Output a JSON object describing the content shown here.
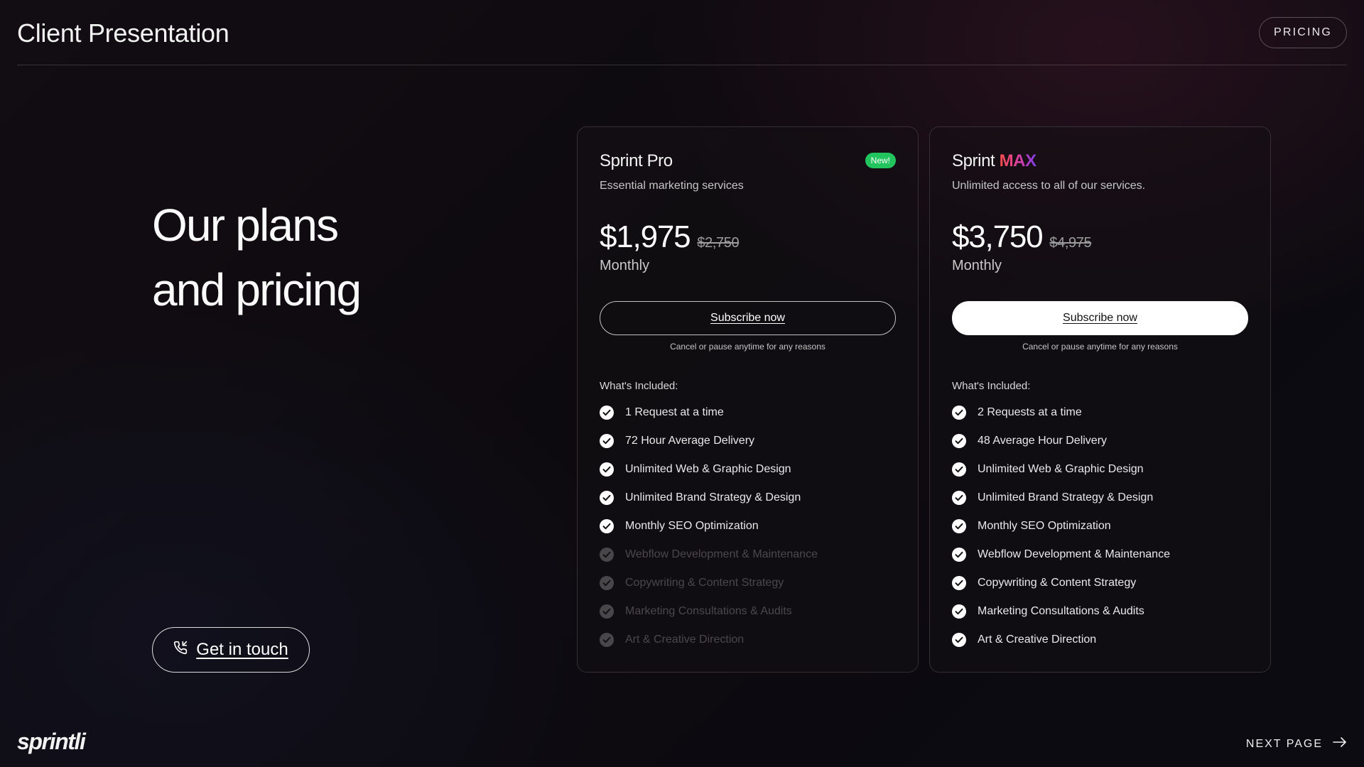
{
  "header": {
    "title": "Client Presentation",
    "nav_label": "PRICING"
  },
  "hero": {
    "line1": "Our plans",
    "line2": "and pricing",
    "contact_label": "Get in touch",
    "contact_icon": "phone-icon"
  },
  "plans": [
    {
      "name": "Sprint Pro",
      "badge": "New!",
      "description": "Essential marketing services",
      "price": "$1,975",
      "old_price": "$2,750",
      "period": "Monthly",
      "cta": "Subscribe now",
      "cancel_note": "Cancel or pause anytime for any reasons",
      "included_title": "What's Included:",
      "features": [
        {
          "label": "1 Request at a time",
          "enabled": true
        },
        {
          "label": "72 Hour Average Delivery",
          "enabled": true
        },
        {
          "label": "Unlimited Web & Graphic Design",
          "enabled": true
        },
        {
          "label": "Unlimited Brand Strategy & Design",
          "enabled": true
        },
        {
          "label": "Monthly SEO Optimization",
          "enabled": true
        },
        {
          "label": "Webflow Development & Maintenance",
          "enabled": false
        },
        {
          "label": "Copywriting & Content Strategy",
          "enabled": false
        },
        {
          "label": "Marketing Consultations & Audits",
          "enabled": false
        },
        {
          "label": "Art & Creative Direction",
          "enabled": false
        }
      ]
    },
    {
      "name_prefix": "Sprint",
      "name_accent": "MAX",
      "description": "Unlimited access to all of our services.",
      "price": "$3,750",
      "old_price": "$4,975",
      "period": "Monthly",
      "cta": "Subscribe now",
      "cancel_note": "Cancel or pause anytime for any reasons",
      "included_title": "What's Included:",
      "features": [
        {
          "label": "2 Requests at a time",
          "enabled": true
        },
        {
          "label": "48 Average Hour Delivery",
          "enabled": true
        },
        {
          "label": "Unlimited Web & Graphic Design",
          "enabled": true
        },
        {
          "label": "Unlimited Brand Strategy & Design",
          "enabled": true
        },
        {
          "label": "Monthly SEO Optimization",
          "enabled": true
        },
        {
          "label": "Webflow Development & Maintenance",
          "enabled": true
        },
        {
          "label": "Copywriting & Content Strategy",
          "enabled": true
        },
        {
          "label": "Marketing Consultations & Audits",
          "enabled": true
        },
        {
          "label": "Art & Creative Direction",
          "enabled": true
        }
      ]
    }
  ],
  "footer": {
    "logo": "sprintli",
    "next_label": "NEXT PAGE",
    "next_icon": "arrow-right-icon"
  },
  "colors": {
    "badge_green": "#22c45e",
    "max_gradient_start": "#ff4d4d",
    "max_gradient_end": "#7c3bea"
  }
}
